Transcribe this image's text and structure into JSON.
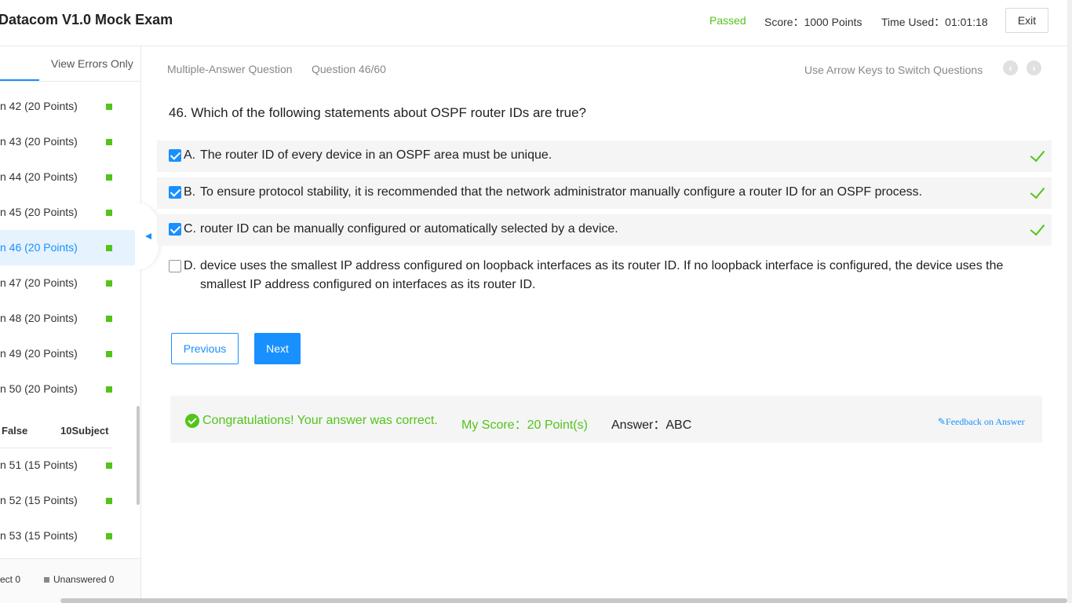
{
  "header": {
    "title": "Datacom V1.0 Mock Exam",
    "status": "Passed",
    "score": "Score：1000 Points",
    "time_used": "Time Used：01:01:18",
    "exit_label": "Exit"
  },
  "sidebar": {
    "tab_errors_label": "View Errors Only",
    "items": [
      {
        "label": "n 42   (20 Points)"
      },
      {
        "label": "n 43   (20 Points)"
      },
      {
        "label": "n 44   (20 Points)"
      },
      {
        "label": "n 45   (20 Points)"
      },
      {
        "label": "n 46   (20 Points)"
      },
      {
        "label": "n 47   (20 Points)"
      },
      {
        "label": "n 48   (20 Points)"
      },
      {
        "label": "n 49   (20 Points)"
      },
      {
        "label": "n 50   (20 Points)"
      }
    ],
    "section": {
      "left": "False",
      "right": "10Subject"
    },
    "items2": [
      {
        "label": "n 51   (15 Points)"
      },
      {
        "label": "n 52   (15 Points)"
      },
      {
        "label": "n 53   (15 Points)"
      }
    ],
    "footer": {
      "left": "ect 0",
      "right": "Unanswered 0"
    },
    "colors": {
      "answered": "#52c41a",
      "active_bg": "#e6f2fd"
    }
  },
  "main": {
    "question_type": "Multiple-Answer Question",
    "question_number": "Question 46/60",
    "hint": "Use Arrow Keys to Switch Questions",
    "prev_icon": "chevron-left-icon",
    "next_icon": "chevron-right-icon",
    "question": "46. Which of the following statements about OSPF router IDs are true?",
    "options": [
      {
        "letter": "A.",
        "text": "The router ID of every device in an OSPF area must be unique.",
        "checked": true,
        "correct": true
      },
      {
        "letter": "B.",
        "text": "To ensure protocol stability, it is recommended that the network administrator manually configure a router ID for an OSPF process.",
        "checked": true,
        "correct": true
      },
      {
        "letter": "C.",
        "text": "router ID can be manually configured or automatically selected by a device.",
        "checked": true,
        "correct": true
      },
      {
        "letter": "D.",
        "text": "device uses the smallest IP address configured on loopback interfaces as its router ID. If no loopback interface is configured, the device uses the smallest IP address configured on interfaces as its router ID.",
        "checked": false,
        "correct": false
      }
    ],
    "previous_label": "Previous",
    "next_label": "Next",
    "result": {
      "message": "Congratulations! Your answer was correct.",
      "my_score": "My Score：20 Point(s)",
      "answer": "Answer：ABC",
      "feedback": "✎Feedback on Answer"
    },
    "colors": {
      "accent": "#1890ff",
      "success": "#52c41a"
    }
  }
}
